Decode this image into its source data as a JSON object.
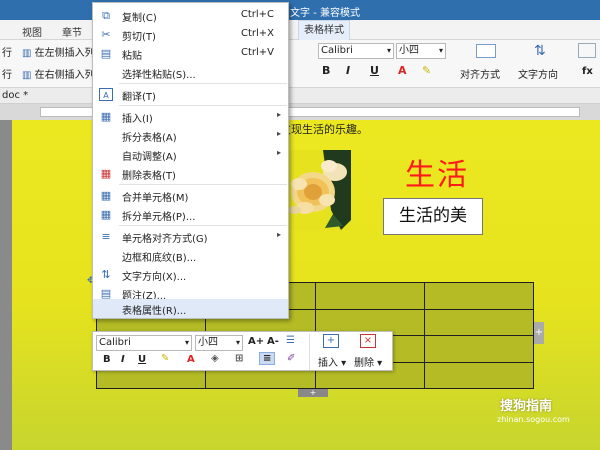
{
  "title_bar": {
    "title": "文字 - 兼容模式"
  },
  "tabs": [
    {
      "label": "视图"
    },
    {
      "label": "章节"
    },
    {
      "label": "表格样式"
    }
  ],
  "ribbon": {
    "insert_left_label": "在左侧插入列",
    "insert_right_label": "在右侧插入列",
    "row_label_1": "行",
    "row_label_2": "行",
    "font_name": "Calibri",
    "font_size": "小四",
    "bold": "B",
    "italic": "I",
    "underline": "U",
    "font_color": "A",
    "align_label": "对齐方式",
    "text_direction_label": "文字方向",
    "fx_label": "fx"
  },
  "doc_tab": {
    "name": "doc *"
  },
  "document": {
    "top_text": "发现生活的乐趣。",
    "heading_big": "生活",
    "heading_box": "生活的美"
  },
  "context_menu": {
    "items": [
      {
        "label": "复制(C)",
        "shortcut": "Ctrl+C",
        "icon": "copy-icon",
        "glyph": "⧉"
      },
      {
        "label": "剪切(T)",
        "shortcut": "Ctrl+X",
        "icon": "scissors-icon",
        "glyph": "✂"
      },
      {
        "label": "粘贴",
        "shortcut": "Ctrl+V",
        "icon": "paste-icon",
        "glyph": "📋"
      },
      {
        "label": "选择性粘贴(S)...",
        "shortcut": "",
        "icon": "paste-special-icon",
        "glyph": ""
      },
      {
        "label": "翻译(T)",
        "shortcut": "",
        "icon": "translate-icon",
        "glyph": "A"
      },
      {
        "label": "插入(I)",
        "shortcut": "",
        "icon": "table-insert-icon",
        "glyph": "▦",
        "submenu": true
      },
      {
        "label": "拆分表格(A)",
        "shortcut": "",
        "icon": "",
        "glyph": "",
        "submenu": true
      },
      {
        "label": "自动调整(A)",
        "shortcut": "",
        "icon": "",
        "glyph": "",
        "submenu": true
      },
      {
        "label": "删除表格(T)",
        "shortcut": "",
        "icon": "delete-table-icon",
        "glyph": "▦"
      },
      {
        "label": "合并单元格(M)",
        "shortcut": "",
        "icon": "merge-cells-icon",
        "glyph": "▦"
      },
      {
        "label": "拆分单元格(P)...",
        "shortcut": "",
        "icon": "split-cells-icon",
        "glyph": "▦"
      },
      {
        "label": "单元格对齐方式(G)",
        "shortcut": "",
        "icon": "cell-align-icon",
        "glyph": "≡",
        "submenu": true
      },
      {
        "label": "边框和底纹(B)...",
        "shortcut": "",
        "icon": "",
        "glyph": ""
      },
      {
        "label": "文字方向(X)...",
        "shortcut": "",
        "icon": "text-direction-icon",
        "glyph": "⇅"
      },
      {
        "label": "题注(Z)...",
        "shortcut": "",
        "icon": "caption-icon",
        "glyph": "▤"
      },
      {
        "label": "表格属性(R)...",
        "shortcut": "",
        "icon": "",
        "glyph": ""
      }
    ]
  },
  "mini_toolbar": {
    "font_name": "Calibri",
    "font_size": "小四",
    "grow_font": "A+",
    "shrink_font": "A-",
    "bold": "B",
    "italic": "I",
    "underline": "U",
    "font_color": "A",
    "insert_label": "插入",
    "delete_label": "删除"
  },
  "watermark": {
    "brand": "搜狗指南",
    "url": "zhinan.sogou.com"
  },
  "colors": {
    "accent": "#2f6fae",
    "heading_red": "#ff1a1a",
    "page_yellow": "#e6e31e",
    "table_green": "#b4bb24"
  }
}
